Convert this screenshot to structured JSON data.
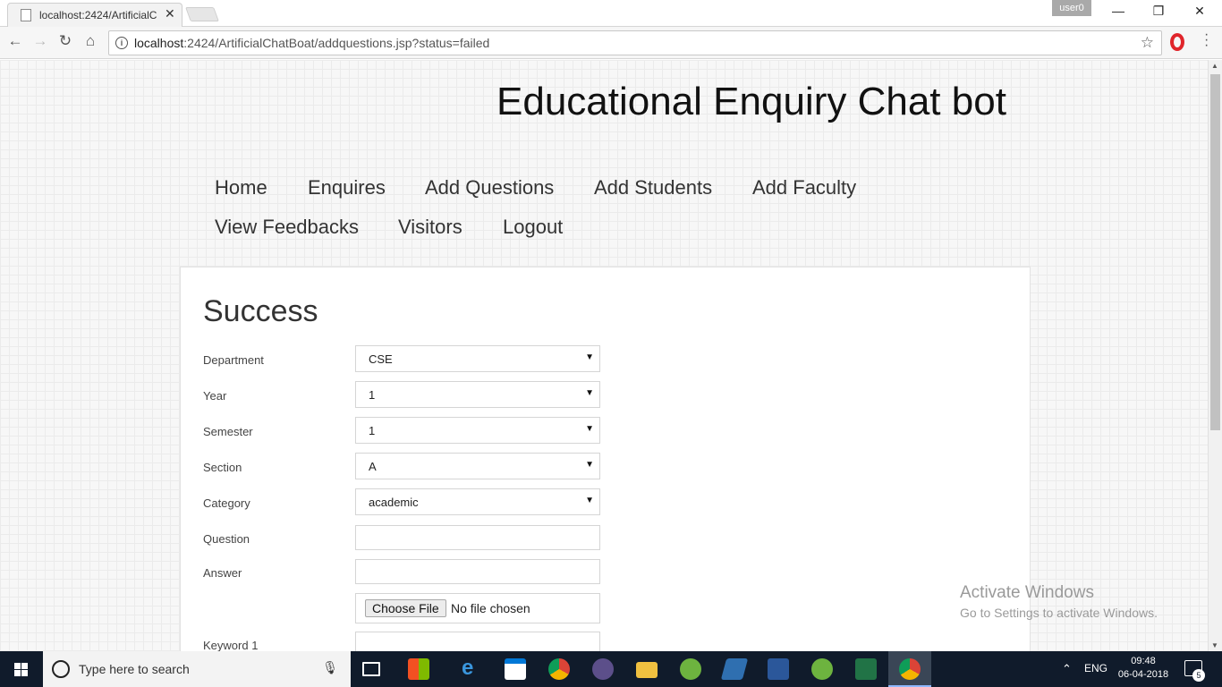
{
  "browser": {
    "tab_title": "localhost:2424/ArtificialC",
    "user_badge": "user0",
    "url_host": "localhost",
    "url_rest": ":2424/ArtificialChatBoat/addquestions.jsp?status=failed"
  },
  "site": {
    "title": "Educational Enquiry Chat bot"
  },
  "nav": {
    "items": [
      "Home",
      "Enquires",
      "Add Questions",
      "Add Students",
      "Add Faculty",
      "View Feedbacks",
      "Visitors",
      "Logout"
    ]
  },
  "form": {
    "heading": "Success",
    "department_label": "Department",
    "department_value": "CSE",
    "year_label": "Year",
    "year_value": "1",
    "semester_label": "Semester",
    "semester_value": "1",
    "section_label": "Section",
    "section_value": "A",
    "category_label": "Category",
    "category_value": "academic",
    "question_label": "Question",
    "question_value": "",
    "answer_label": "Answer",
    "answer_value": "",
    "file_button": "Choose File",
    "file_status": "No file chosen",
    "keyword1_label": "Keyword 1"
  },
  "watermark": {
    "line1": "Activate Windows",
    "line2": "Go to Settings to activate Windows."
  },
  "taskbar": {
    "search_placeholder": "Type here to search",
    "language": "ENG",
    "time": "09:48",
    "date": "06-04-2018",
    "notification_count": "5"
  }
}
